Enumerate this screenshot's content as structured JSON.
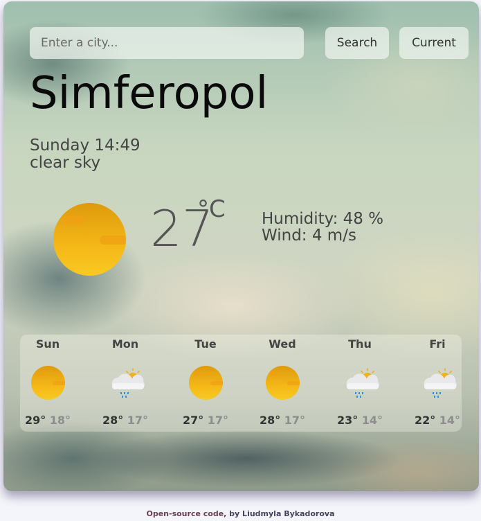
{
  "search": {
    "placeholder": "Enter a city...",
    "value": "",
    "search_label": "Search",
    "current_label": "Current"
  },
  "current": {
    "city": "Simferopol",
    "datetime": "Sunday 14:49",
    "description": "clear sky",
    "icon": "clear-sky-sun-icon",
    "temperature": "27",
    "unit": "°C",
    "humidity": "Humidity: 48 %",
    "wind": "Wind: 4 m/s"
  },
  "forecast": [
    {
      "day": "Sun",
      "icon": "sun",
      "max": "29°",
      "min": "18°"
    },
    {
      "day": "Mon",
      "icon": "rain",
      "max": "28°",
      "min": "17°"
    },
    {
      "day": "Tue",
      "icon": "sun",
      "max": "27°",
      "min": "17°"
    },
    {
      "day": "Wed",
      "icon": "sun",
      "max": "28°",
      "min": "17°"
    },
    {
      "day": "Thu",
      "icon": "rain",
      "max": "23°",
      "min": "14°"
    },
    {
      "day": "Fri",
      "icon": "rain",
      "max": "22°",
      "min": "14°"
    }
  ],
  "footer": {
    "link_text": "Open-source code",
    "rest": ", by Liudmyla Bykadorova"
  },
  "colors": {
    "sun": "#f4b818",
    "rain_drop": "#2f8fd8"
  }
}
